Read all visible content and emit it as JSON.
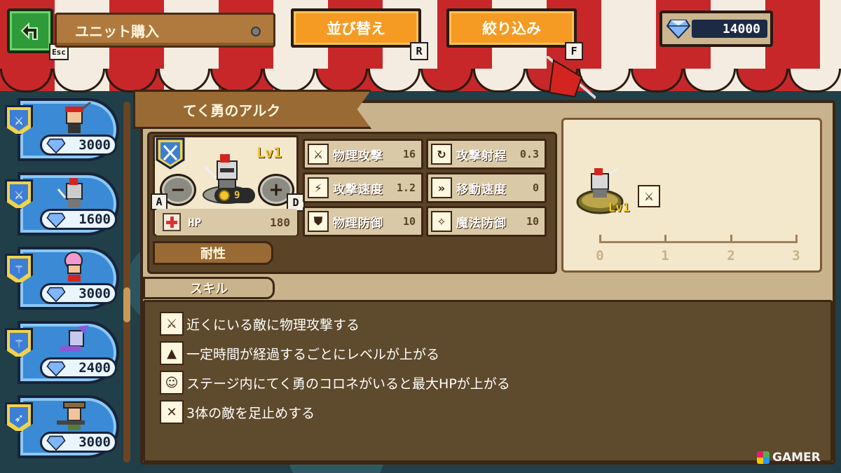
{
  "header": {
    "title": "ユニット購入",
    "back_hint": "Esc",
    "sort_label": "並び替え",
    "sort_hint": "R",
    "filter_label": "絞り込み",
    "filter_hint": "F",
    "gems": "14000"
  },
  "unit_list": [
    {
      "cost": "3000"
    },
    {
      "cost": "1600"
    },
    {
      "cost": "3000"
    },
    {
      "cost": "2400"
    },
    {
      "cost": "3000"
    }
  ],
  "detail": {
    "name": "てく勇のアルク",
    "level": "Lv1",
    "upgrade_cost": "9",
    "minus_hint": "A",
    "plus_hint": "D",
    "hp_label": "HP",
    "hp_value": "180",
    "resist_label": "耐性",
    "stats": [
      {
        "label": "物理攻撃",
        "value": "16",
        "icon": "sword-icon"
      },
      {
        "label": "攻撃射程",
        "value": "0.3",
        "icon": "range-icon"
      },
      {
        "label": "攻撃速度",
        "value": "1.2",
        "icon": "speed-icon"
      },
      {
        "label": "移動速度",
        "value": "0",
        "icon": "move-icon"
      },
      {
        "label": "物理防御",
        "value": "10",
        "icon": "shield-icon"
      },
      {
        "label": "魔法防御",
        "value": "10",
        "icon": "magic-shield-icon"
      }
    ],
    "range_level": "Lv1",
    "range_axis": [
      "0",
      "1",
      "2",
      "3"
    ]
  },
  "skills": {
    "tab_label": "スキル",
    "items": [
      {
        "text": "近くにいる敵に物理攻撃する",
        "icon": "melee-attack-icon"
      },
      {
        "text": "一定時間が経過するごとにレベルが上がる",
        "icon": "level-up-icon"
      },
      {
        "text": "ステージ内にてく勇のコロネがいると最大HPが上がる",
        "icon": "face-icon"
      },
      {
        "text": "3体の敵を足止めする",
        "icon": "block-icon"
      }
    ]
  },
  "watermark": "GAMER",
  "colors": {
    "awning_red": "#c8272a",
    "awning_white": "#f4ece0",
    "button_orange": "#f59b23",
    "card_blue": "#3a8ad6",
    "panel_tan": "#c9b38c",
    "skill_bg": "#5e4a2c"
  }
}
